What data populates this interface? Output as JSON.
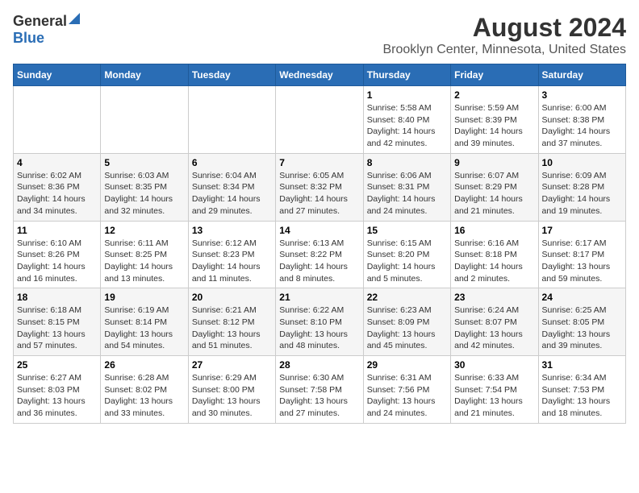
{
  "header": {
    "logo_general": "General",
    "logo_blue": "Blue",
    "title": "August 2024",
    "subtitle": "Brooklyn Center, Minnesota, United States"
  },
  "days_of_week": [
    "Sunday",
    "Monday",
    "Tuesday",
    "Wednesday",
    "Thursday",
    "Friday",
    "Saturday"
  ],
  "weeks": [
    [
      {
        "day": "",
        "info": ""
      },
      {
        "day": "",
        "info": ""
      },
      {
        "day": "",
        "info": ""
      },
      {
        "day": "",
        "info": ""
      },
      {
        "day": "1",
        "info": "Sunrise: 5:58 AM\nSunset: 8:40 PM\nDaylight: 14 hours\nand 42 minutes."
      },
      {
        "day": "2",
        "info": "Sunrise: 5:59 AM\nSunset: 8:39 PM\nDaylight: 14 hours\nand 39 minutes."
      },
      {
        "day": "3",
        "info": "Sunrise: 6:00 AM\nSunset: 8:38 PM\nDaylight: 14 hours\nand 37 minutes."
      }
    ],
    [
      {
        "day": "4",
        "info": "Sunrise: 6:02 AM\nSunset: 8:36 PM\nDaylight: 14 hours\nand 34 minutes."
      },
      {
        "day": "5",
        "info": "Sunrise: 6:03 AM\nSunset: 8:35 PM\nDaylight: 14 hours\nand 32 minutes."
      },
      {
        "day": "6",
        "info": "Sunrise: 6:04 AM\nSunset: 8:34 PM\nDaylight: 14 hours\nand 29 minutes."
      },
      {
        "day": "7",
        "info": "Sunrise: 6:05 AM\nSunset: 8:32 PM\nDaylight: 14 hours\nand 27 minutes."
      },
      {
        "day": "8",
        "info": "Sunrise: 6:06 AM\nSunset: 8:31 PM\nDaylight: 14 hours\nand 24 minutes."
      },
      {
        "day": "9",
        "info": "Sunrise: 6:07 AM\nSunset: 8:29 PM\nDaylight: 14 hours\nand 21 minutes."
      },
      {
        "day": "10",
        "info": "Sunrise: 6:09 AM\nSunset: 8:28 PM\nDaylight: 14 hours\nand 19 minutes."
      }
    ],
    [
      {
        "day": "11",
        "info": "Sunrise: 6:10 AM\nSunset: 8:26 PM\nDaylight: 14 hours\nand 16 minutes."
      },
      {
        "day": "12",
        "info": "Sunrise: 6:11 AM\nSunset: 8:25 PM\nDaylight: 14 hours\nand 13 minutes."
      },
      {
        "day": "13",
        "info": "Sunrise: 6:12 AM\nSunset: 8:23 PM\nDaylight: 14 hours\nand 11 minutes."
      },
      {
        "day": "14",
        "info": "Sunrise: 6:13 AM\nSunset: 8:22 PM\nDaylight: 14 hours\nand 8 minutes."
      },
      {
        "day": "15",
        "info": "Sunrise: 6:15 AM\nSunset: 8:20 PM\nDaylight: 14 hours\nand 5 minutes."
      },
      {
        "day": "16",
        "info": "Sunrise: 6:16 AM\nSunset: 8:18 PM\nDaylight: 14 hours\nand 2 minutes."
      },
      {
        "day": "17",
        "info": "Sunrise: 6:17 AM\nSunset: 8:17 PM\nDaylight: 13 hours\nand 59 minutes."
      }
    ],
    [
      {
        "day": "18",
        "info": "Sunrise: 6:18 AM\nSunset: 8:15 PM\nDaylight: 13 hours\nand 57 minutes."
      },
      {
        "day": "19",
        "info": "Sunrise: 6:19 AM\nSunset: 8:14 PM\nDaylight: 13 hours\nand 54 minutes."
      },
      {
        "day": "20",
        "info": "Sunrise: 6:21 AM\nSunset: 8:12 PM\nDaylight: 13 hours\nand 51 minutes."
      },
      {
        "day": "21",
        "info": "Sunrise: 6:22 AM\nSunset: 8:10 PM\nDaylight: 13 hours\nand 48 minutes."
      },
      {
        "day": "22",
        "info": "Sunrise: 6:23 AM\nSunset: 8:09 PM\nDaylight: 13 hours\nand 45 minutes."
      },
      {
        "day": "23",
        "info": "Sunrise: 6:24 AM\nSunset: 8:07 PM\nDaylight: 13 hours\nand 42 minutes."
      },
      {
        "day": "24",
        "info": "Sunrise: 6:25 AM\nSunset: 8:05 PM\nDaylight: 13 hours\nand 39 minutes."
      }
    ],
    [
      {
        "day": "25",
        "info": "Sunrise: 6:27 AM\nSunset: 8:03 PM\nDaylight: 13 hours\nand 36 minutes."
      },
      {
        "day": "26",
        "info": "Sunrise: 6:28 AM\nSunset: 8:02 PM\nDaylight: 13 hours\nand 33 minutes."
      },
      {
        "day": "27",
        "info": "Sunrise: 6:29 AM\nSunset: 8:00 PM\nDaylight: 13 hours\nand 30 minutes."
      },
      {
        "day": "28",
        "info": "Sunrise: 6:30 AM\nSunset: 7:58 PM\nDaylight: 13 hours\nand 27 minutes."
      },
      {
        "day": "29",
        "info": "Sunrise: 6:31 AM\nSunset: 7:56 PM\nDaylight: 13 hours\nand 24 minutes."
      },
      {
        "day": "30",
        "info": "Sunrise: 6:33 AM\nSunset: 7:54 PM\nDaylight: 13 hours\nand 21 minutes."
      },
      {
        "day": "31",
        "info": "Sunrise: 6:34 AM\nSunset: 7:53 PM\nDaylight: 13 hours\nand 18 minutes."
      }
    ]
  ]
}
